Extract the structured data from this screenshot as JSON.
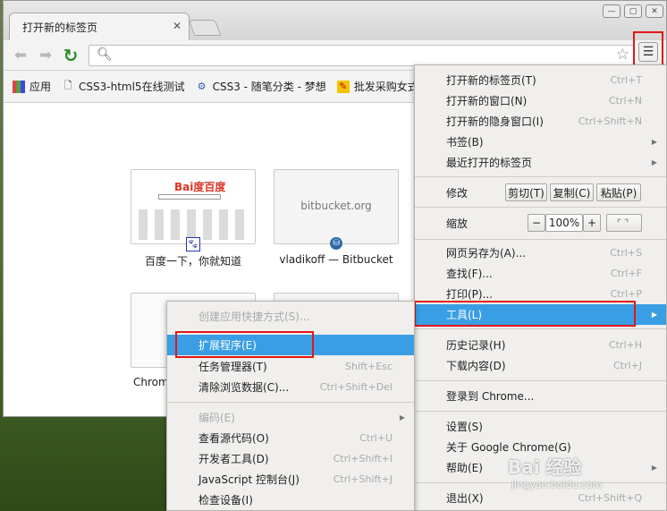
{
  "tab": {
    "title": "打开新的标签页",
    "close": "✕"
  },
  "window_controls": {
    "minimize": "—",
    "maximize": "▢",
    "close": "✕"
  },
  "bookmarks": [
    {
      "label": "应用",
      "icon": "apps-icon"
    },
    {
      "label": "CSS3-html5在线测试",
      "icon": "page-icon"
    },
    {
      "label": "CSS3 - 随笔分类 - 梦想",
      "icon": "cnblogs-icon"
    },
    {
      "label": "批发采购女式",
      "icon": "shop-icon"
    }
  ],
  "thumbnails": [
    {
      "caption": "百度一下，你就知道",
      "logo": "Bai度百度"
    },
    {
      "caption": "vladikoff — Bitbucket",
      "center_text": "bitbucket.org"
    },
    {
      "caption": "Chrome"
    }
  ],
  "main_menu": {
    "items": [
      {
        "label": "打开新的标签页(T)",
        "shortcut": "Ctrl+T"
      },
      {
        "label": "打开新的窗口(N)",
        "shortcut": "Ctrl+N"
      },
      {
        "label": "打开新的隐身窗口(I)",
        "shortcut": "Ctrl+Shift+N"
      },
      {
        "label": "书签(B)",
        "shortcut": ""
      },
      {
        "label": "最近打开的标签页",
        "shortcut": ""
      }
    ],
    "edit": {
      "label": "修改",
      "cut": "剪切(T)",
      "copy": "复制(C)",
      "paste": "粘贴(P)"
    },
    "zoom": {
      "label": "缩放",
      "minus": "−",
      "value": "100%",
      "plus": "+"
    },
    "page_items": [
      {
        "label": "网页另存为(A)...",
        "shortcut": "Ctrl+S"
      },
      {
        "label": "查找(F)...",
        "shortcut": "Ctrl+F"
      },
      {
        "label": "打印(P)...",
        "shortcut": "Ctrl+P"
      },
      {
        "label": "工具(L)",
        "shortcut": ""
      }
    ],
    "history_items": [
      {
        "label": "历史记录(H)",
        "shortcut": "Ctrl+H"
      },
      {
        "label": "下载内容(D)",
        "shortcut": "Ctrl+J"
      }
    ],
    "signin": {
      "label": "登录到 Chrome..."
    },
    "settings_items": [
      {
        "label": "设置(S)"
      },
      {
        "label": "关于 Google Chrome(G)"
      },
      {
        "label": "帮助(E)"
      }
    ],
    "exit": {
      "label": "退出(X)",
      "shortcut": "Ctrl+Shift+Q"
    }
  },
  "tools_menu": {
    "items": [
      {
        "label": "创建应用快捷方式(S)...",
        "shortcut": ""
      },
      {
        "label": "扩展程序(E)",
        "shortcut": ""
      },
      {
        "label": "任务管理器(T)",
        "shortcut": "Shift+Esc"
      },
      {
        "label": "清除浏览数据(C)...",
        "shortcut": "Ctrl+Shift+Del"
      }
    ],
    "dev_items": [
      {
        "label": "编码(E)",
        "shortcut": ""
      },
      {
        "label": "查看源代码(O)",
        "shortcut": "Ctrl+U"
      },
      {
        "label": "开发者工具(D)",
        "shortcut": "Ctrl+Shift+I"
      },
      {
        "label": "JavaScript 控制台(J)",
        "shortcut": "Ctrl+Shift+J"
      },
      {
        "label": "检查设备(I)",
        "shortcut": ""
      }
    ]
  },
  "watermark": {
    "brand": "Bai 经验",
    "url": "jingyan.baidu.com"
  },
  "colors": {
    "highlight": "#3a9ee4",
    "annotation_red": "#e01717"
  }
}
